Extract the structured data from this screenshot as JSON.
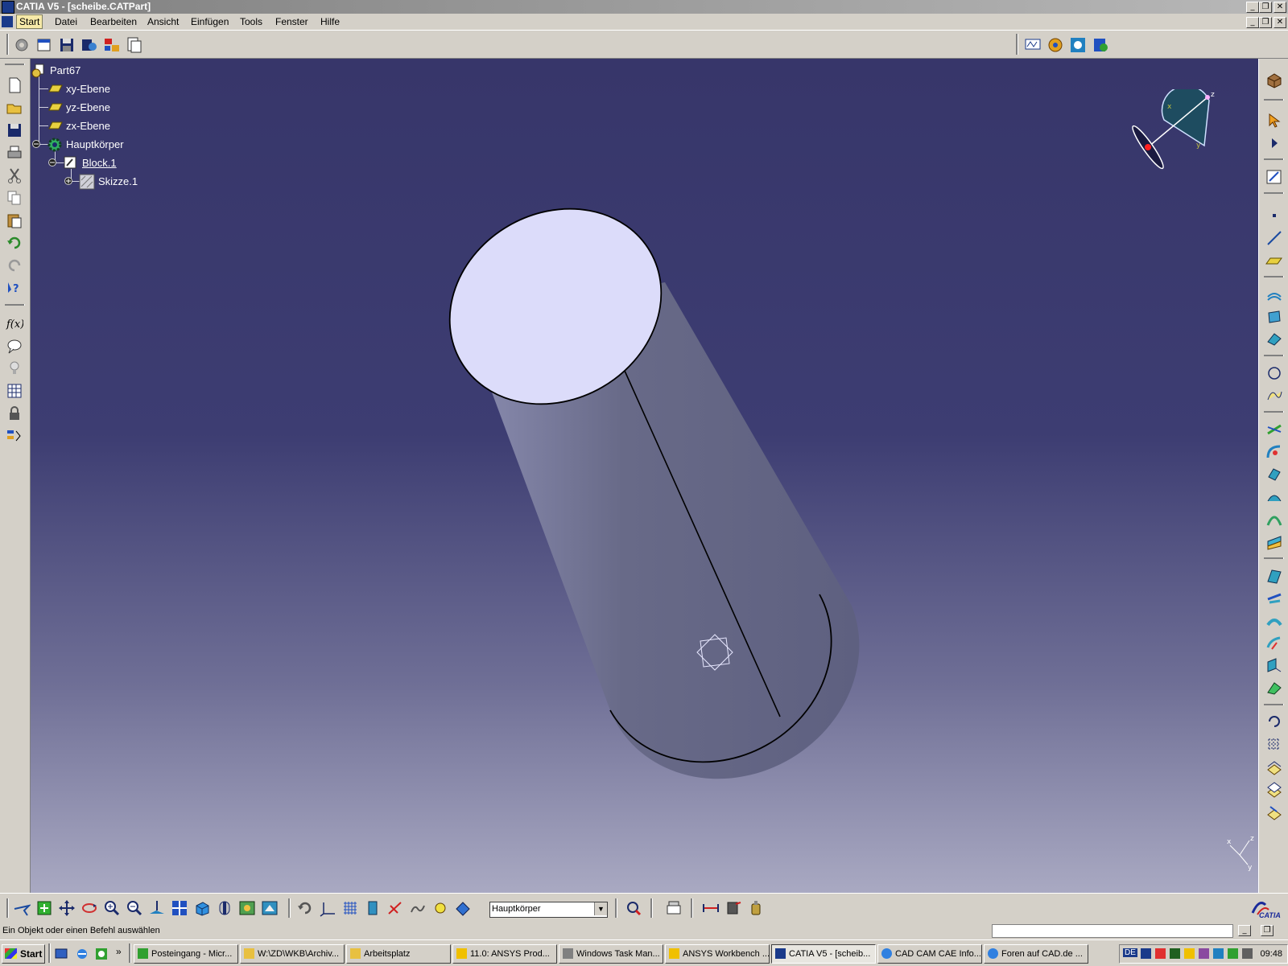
{
  "window": {
    "title": "CATIA V5 - [scheibe.CATPart]",
    "minimize_glyph": "_",
    "restore_glyph": "❐",
    "close_glyph": "✕"
  },
  "menu": {
    "items": [
      "Start",
      "Datei",
      "Bearbeiten",
      "Ansicht",
      "Einfügen",
      "Tools",
      "Fenster",
      "Hilfe"
    ]
  },
  "tree": {
    "root": "Part67",
    "planes": [
      "xy-Ebene",
      "yz-Ebene",
      "zx-Ebene"
    ],
    "body": "Hauptkörper",
    "feature": "Block.1",
    "sketch": "Skizze.1"
  },
  "compass": {
    "axes": [
      "x",
      "y",
      "z"
    ]
  },
  "mini_axis": {
    "axes": [
      "x",
      "y",
      "z"
    ]
  },
  "bottom_toolbar": {
    "current_body": "Hauptkörper"
  },
  "brand": {
    "logo_text": "CATIA"
  },
  "status": {
    "message": "Ein Objekt oder einen Befehl auswählen"
  },
  "taskbar": {
    "start_label": "Start",
    "more_glyph": "»",
    "tasks": [
      "Posteingang - Micr...",
      "W:\\ZD\\WKB\\Archiv...",
      "Arbeitsplatz",
      "11.0: ANSYS Prod...",
      "Windows Task Man...",
      "ANSYS Workbench ...",
      "CATIA V5 - [scheib...",
      "CAD CAM CAE Info...",
      "Foren auf CAD.de ..."
    ],
    "language": "DE",
    "clock": "09:48"
  },
  "colors": {
    "viewport_top": "#37366a",
    "viewport_bottom": "#a9a9c2",
    "cylinder_side": "#666a86",
    "cylinder_top": "#dcdcfa",
    "menu_highlight": "#f6e9a8"
  }
}
